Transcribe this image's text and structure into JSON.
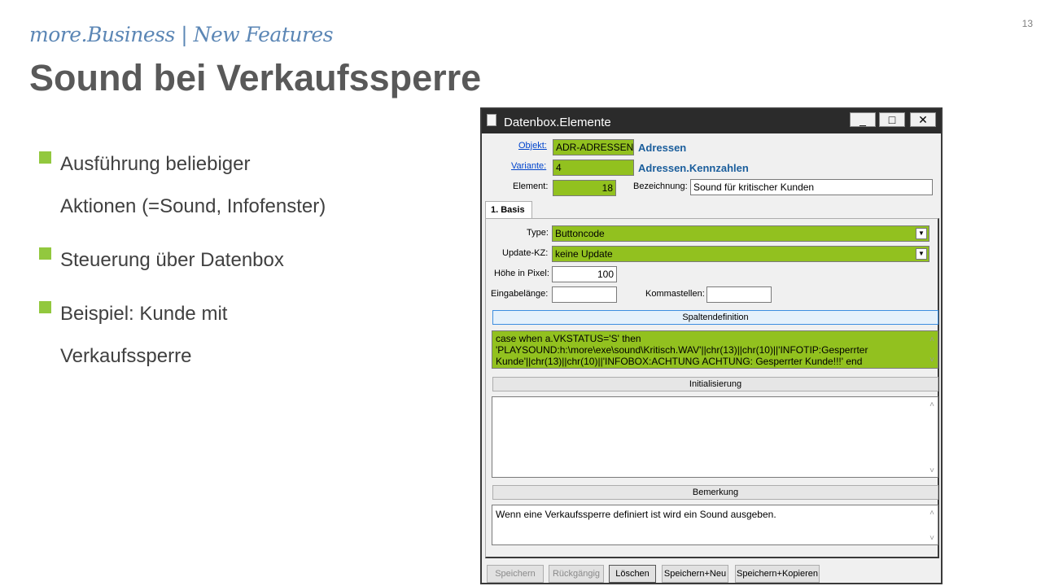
{
  "slide": {
    "subtitle": "more.Business | New Features",
    "title": "Sound bei Verkaufssperre",
    "page_number": "13",
    "bullets": [
      {
        "lines": [
          "Ausführung beliebiger",
          "Aktionen (=Sound, Infofenster)"
        ]
      },
      {
        "lines": [
          "Steuerung über Datenbox"
        ]
      },
      {
        "lines": [
          "Beispiel: Kunde mit",
          "Verkaufssperre"
        ]
      }
    ],
    "accent_color": "#92c83e"
  },
  "window": {
    "title": "Datenbox.Elemente",
    "buttons": {
      "minimize": "_",
      "maximize": "□",
      "close": "✕"
    },
    "objekt_label": "Objekt:",
    "objekt_value": "ADR-ADRESSEN-B",
    "objekt_name": "Adressen",
    "variante_label": "Variante:",
    "variante_value": "4",
    "variante_name": "Adressen.Kennzahlen",
    "element_label": "Element:",
    "element_value": "18",
    "bezeichnung_label": "Bezeichnung:",
    "bezeichnung_value": "Sound für kritischer Kunden",
    "tab_label": "1. Basis",
    "type_label": "Type:",
    "type_value": "Buttoncode",
    "update_label": "Update-KZ:",
    "update_value": "keine Update",
    "hoehe_label": "Höhe in Pixel:",
    "hoehe_value": "100",
    "eingabe_label": "Eingabelänge:",
    "eingabe_value": "",
    "komma_label": "Kommastellen:",
    "komma_value": "",
    "spaltendef_label": "Spaltendefinition",
    "spaltendef_value": "case when a.VKSTATUS='S' then 'PLAYSOUND:h:\\more\\exe\\sound\\Kritisch.WAV'||chr(13)||chr(10)||'INFOTIP:Gesperrter Kunde'||chr(13)||chr(10)||'INFOBOX:ACHTUNG ACHTUNG: Gesperrter Kunde!!!' end",
    "init_label": "Initialisierung",
    "init_value": "",
    "bemerkung_label": "Bemerkung",
    "bemerkung_value": "Wenn eine Verkaufssperre definiert ist wird ein Sound ausgeben.",
    "footer_buttons": {
      "speichern": "Speichern",
      "rueckgaengig": "Rückgängig",
      "loeschen": "Löschen",
      "speichern_neu": "Speichern+Neu",
      "speichern_kopieren": "Speichern+Kopieren"
    },
    "field_color": "#92c11f"
  }
}
